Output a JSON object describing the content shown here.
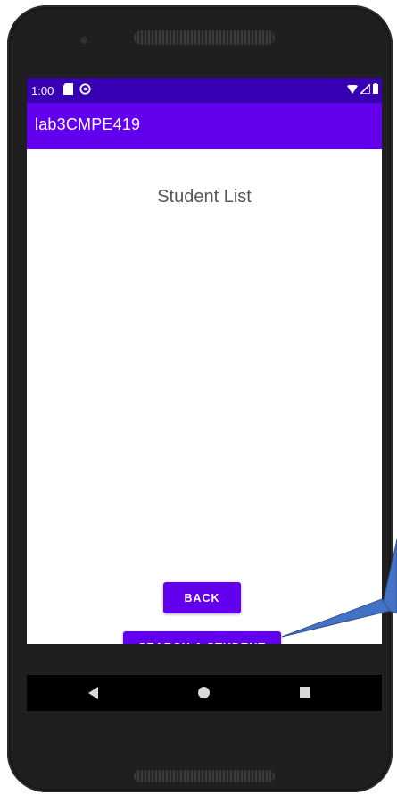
{
  "status_bar": {
    "time": "1:00",
    "left_icons": [
      "sd-card-icon",
      "sync-icon"
    ],
    "right_icons": [
      "wifi-icon",
      "signal-icon",
      "battery-icon"
    ]
  },
  "app_bar": {
    "title": "lab3CMPE419"
  },
  "content": {
    "title": "Student List"
  },
  "buttons": {
    "back_label": "BACK",
    "search_label": "SEARCH A STUDENT"
  },
  "navigation": {
    "items": [
      "back-nav-icon",
      "home-nav-icon",
      "recents-nav-icon"
    ]
  },
  "colors": {
    "status_bar": "#3700b3",
    "app_bar": "#6200ee",
    "button": "#6200ee",
    "callout": "#4472c4"
  }
}
